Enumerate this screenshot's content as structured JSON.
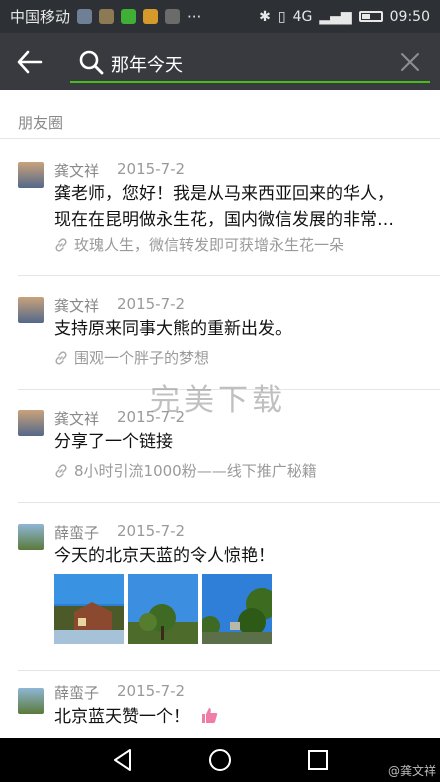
{
  "status_bar": {
    "carrier": "中国移动",
    "network": "4G",
    "time": "09:50"
  },
  "search": {
    "query": "那年今天"
  },
  "section_title": "朋友圈",
  "posts": [
    {
      "name": "龚文祥",
      "date": "2015-7-2",
      "text": "龚老师，您好！我是从马来西亚回来的华人，",
      "text2": "现在在昆明做永生花，国内微信发展的非常…",
      "link": "玫瑰人生，微信转发即可获增永生花一朵"
    },
    {
      "name": "龚文祥",
      "date": "2015-7-2",
      "text": "支持原来同事大熊的重新出发。",
      "link": "围观一个胖子的梦想"
    },
    {
      "name": "龚文祥",
      "date": "2015-7-2",
      "text": "分享了一个链接",
      "link": "8小时引流1000粉——线下推广秘籍"
    },
    {
      "name": "薛蛮子",
      "date": "2015-7-2",
      "text": "今天的北京天蓝的令人惊艳！"
    },
    {
      "name": "薛蛮子",
      "date": "2015-7-2",
      "text": "北京蓝天赞一个！"
    }
  ],
  "watermark": "完美下载",
  "nav_tag": "@龚文祥",
  "colors": {
    "header": "#393a3f",
    "accent": "#45c01a"
  }
}
